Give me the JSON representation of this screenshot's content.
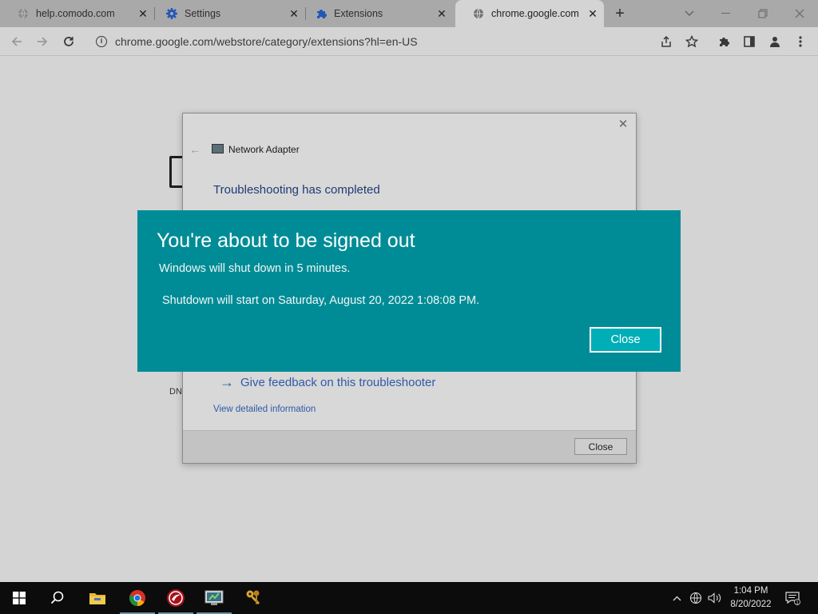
{
  "browser": {
    "tabs": [
      {
        "title": "help.comodo.com",
        "icon": "globe-icon"
      },
      {
        "title": "Settings",
        "icon": "gear-icon"
      },
      {
        "title": "Extensions",
        "icon": "puzzle-icon"
      },
      {
        "title": "chrome.google.com",
        "icon": "globe-icon",
        "active": true
      }
    ],
    "new_tab_label": "+",
    "address": "chrome.google.com/webstore/category/extensions?hl=en-US"
  },
  "background_page": {
    "text_fragment": "DN"
  },
  "troubleshooter": {
    "app_name": "Network Adapter",
    "heading": "Troubleshooting has completed",
    "feedback_link": "Give feedback on this troubleshooter",
    "details_link": "View detailed information",
    "close_label": "Close"
  },
  "signout_banner": {
    "title": "You're about to be signed out",
    "message": "Windows will shut down in 5 minutes.",
    "shutdown_time": "Shutdown will start on Saturday, August 20, 2022 1:08:08 PM.",
    "close_label": "Close",
    "color": "#008c96"
  },
  "taskbar": {
    "apps": [
      "windows-start-icon",
      "search-icon",
      "file-explorer-icon",
      "chrome-icon",
      "comodo-icon",
      "network-troubleshooter-icon",
      "keys-icon"
    ],
    "time": "1:04 PM",
    "date": "8/20/2022",
    "notification_count": "1"
  }
}
